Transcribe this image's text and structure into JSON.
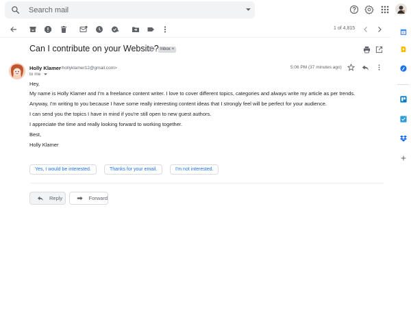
{
  "search": {
    "placeholder": "Search mail"
  },
  "toolbar": {
    "pager_text": "1 of 4,815"
  },
  "email": {
    "subject": "Can I contribute on your Website?",
    "label_chip": "Inbox",
    "sender_name": "Holly Klamer",
    "sender_email": "<hollyklamer12@gmail.com>",
    "to_line": "to me",
    "time": "5:06 PM (37 minutes ago)",
    "body": [
      "Hey,",
      "My name is Holly Klamer and I'm a freelance content writer. I love to cover different topics, categories and always write my article as per trends.",
      "Anyway, I'm writing to you because I have some really interesting content ideas that I strongly feel will be perfect for your audience.",
      "I can send you the topics I have in mind if you're still open to new guest authors.",
      "I appreciate the time and really looking forward to working together.",
      "Best,",
      "Holly Klamer"
    ]
  },
  "smart_replies": [
    "Yes, I would be interested.",
    "Thanks for your email.",
    "I'm not interested."
  ],
  "actions": {
    "reply_label": "Reply",
    "forward_label": "Forward"
  },
  "colors": {
    "accent": "#1a73e8",
    "icon_gray": "#5f6368"
  }
}
